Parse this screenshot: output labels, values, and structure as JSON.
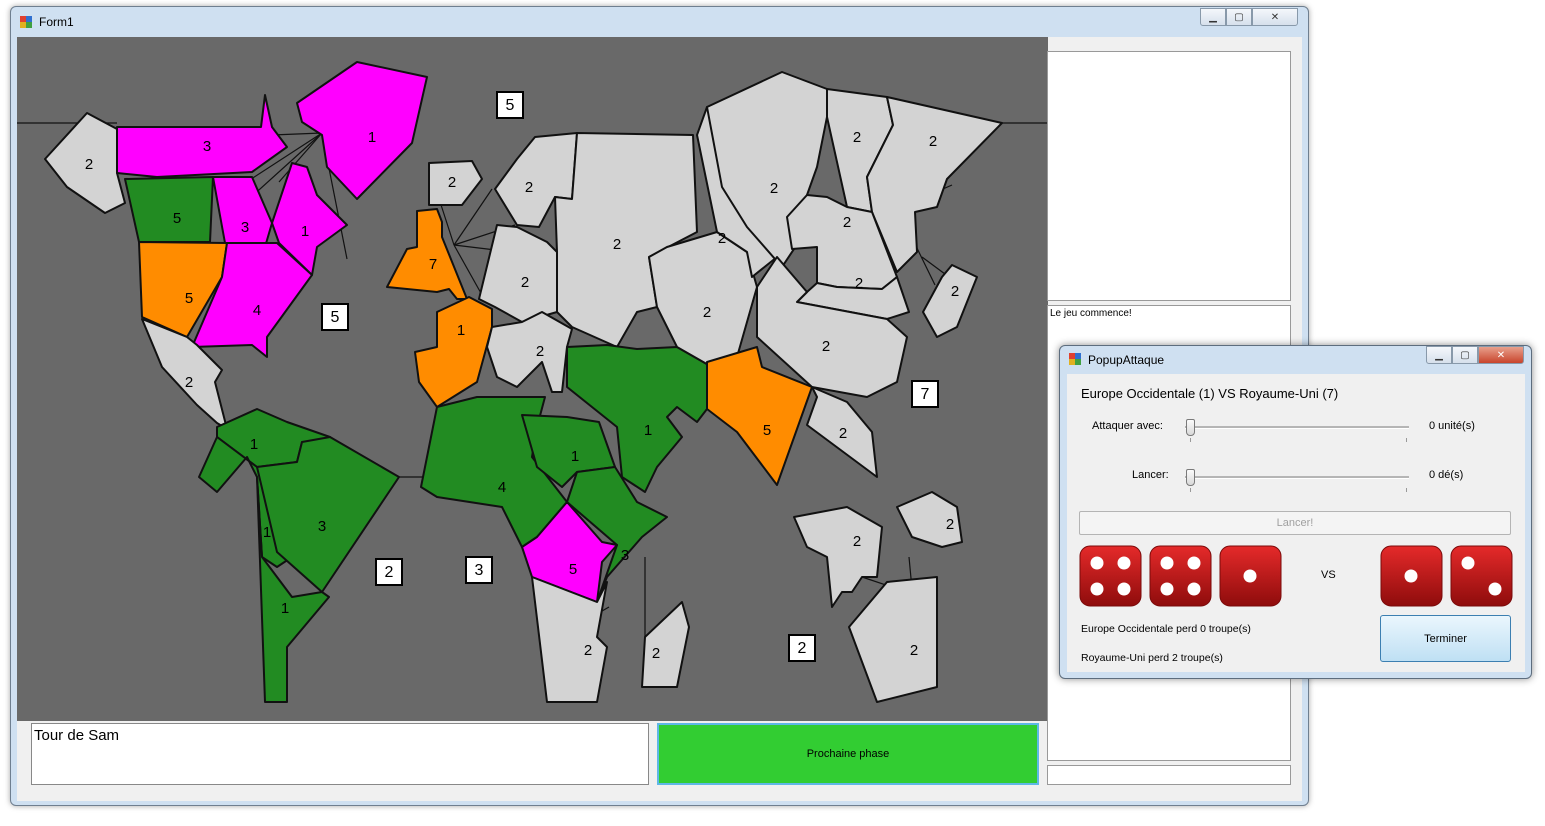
{
  "main_window": {
    "title": "Form1"
  },
  "map": {
    "colors": {
      "background": "#696969",
      "neutral": "#d3d3d3",
      "magenta": "#ff00ff",
      "green": "#228b22",
      "orange": "#ff8c00"
    },
    "continent_bonuses": [
      "5",
      "5",
      "7",
      "2",
      "3",
      "2"
    ],
    "territories": [
      {
        "owner": "neutral",
        "troops": "2"
      },
      {
        "owner": "magenta",
        "troops": "3"
      },
      {
        "owner": "magenta",
        "troops": "1"
      },
      {
        "owner": "green",
        "troops": "5"
      },
      {
        "owner": "magenta",
        "troops": "3"
      },
      {
        "owner": "magenta",
        "troops": "1"
      },
      {
        "owner": "orange",
        "troops": "5"
      },
      {
        "owner": "magenta",
        "troops": "4"
      },
      {
        "owner": "neutral",
        "troops": "2"
      },
      {
        "owner": "green",
        "troops": "1"
      },
      {
        "owner": "green",
        "troops": "1"
      },
      {
        "owner": "green",
        "troops": "3"
      },
      {
        "owner": "green",
        "troops": "1"
      },
      {
        "owner": "neutral",
        "troops": "2"
      },
      {
        "owner": "orange",
        "troops": "7"
      },
      {
        "owner": "orange",
        "troops": "1"
      },
      {
        "owner": "neutral",
        "troops": "2"
      },
      {
        "owner": "neutral",
        "troops": "2"
      },
      {
        "owner": "neutral",
        "troops": "2"
      },
      {
        "owner": "neutral",
        "troops": "2"
      },
      {
        "owner": "green",
        "troops": "4"
      },
      {
        "owner": "green",
        "troops": "1"
      },
      {
        "owner": "green",
        "troops": "3"
      },
      {
        "owner": "magenta",
        "troops": "5"
      },
      {
        "owner": "neutral",
        "troops": "2"
      },
      {
        "owner": "neutral",
        "troops": "2"
      },
      {
        "owner": "green",
        "troops": "1"
      },
      {
        "owner": "neutral",
        "troops": "2"
      },
      {
        "owner": "neutral",
        "troops": "2"
      },
      {
        "owner": "neutral",
        "troops": "2"
      },
      {
        "owner": "neutral",
        "troops": "2"
      },
      {
        "owner": "neutral",
        "troops": "2"
      },
      {
        "owner": "neutral",
        "troops": "2"
      },
      {
        "owner": "neutral",
        "troops": "2"
      },
      {
        "owner": "neutral",
        "troops": "2"
      },
      {
        "owner": "orange",
        "troops": "5"
      },
      {
        "owner": "neutral",
        "troops": "2"
      },
      {
        "owner": "neutral",
        "troops": "2"
      },
      {
        "owner": "neutral",
        "troops": "2"
      },
      {
        "owner": "neutral",
        "troops": "2"
      },
      {
        "owner": "neutral",
        "troops": "2"
      }
    ]
  },
  "status": {
    "turn_text": "Tour de Sam"
  },
  "next_phase": {
    "label": "Prochaine phase"
  },
  "log": {
    "lines": [
      "Le jeu commence!"
    ]
  },
  "popup": {
    "title": "PopupAttaque",
    "matchup": "Europe Occidentale (1) VS Royaume-Uni (7)",
    "attack_label": "Attaquer avec:",
    "attack_value": "0 unité(s)",
    "roll_label": "Lancer:",
    "roll_value": "0 dé(s)",
    "roll_button": "Lancer!",
    "vs": "VS",
    "attacker_dice": [
      4,
      4,
      1
    ],
    "defender_dice": [
      1,
      2
    ],
    "attacker_loss": "Europe Occidentale perd 0 troupe(s)",
    "defender_loss": "Royaume-Uni perd 2 troupe(s)",
    "end_button": "Terminer"
  }
}
